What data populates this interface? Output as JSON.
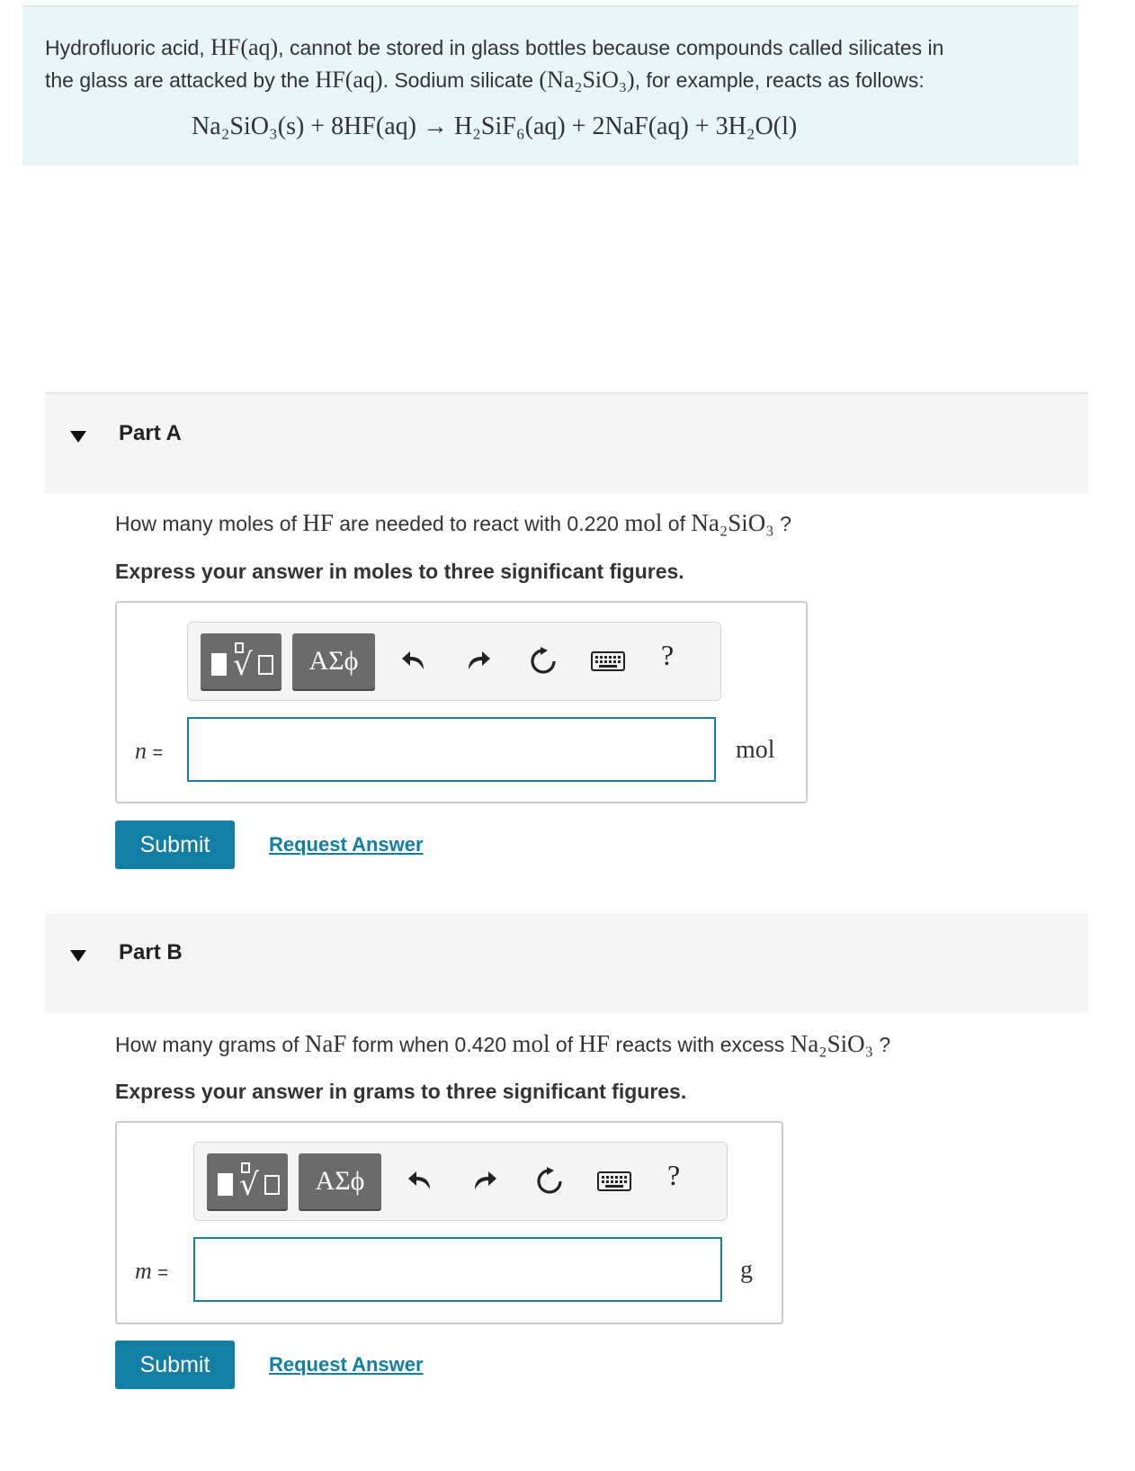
{
  "intro": {
    "line1_a": "Hydrofluoric acid, ",
    "line1_m1": "HF(aq)",
    "line1_b": ", cannot be stored in glass bottles because compounds called silicates in",
    "line2_a": "the glass are attacked by the ",
    "line2_m1": "HF(aq)",
    "line2_b": ". Sodium silicate ",
    "line2_m2": "(Na₂SiO₃)",
    "line2_c": ", for example, reacts as follows:",
    "equation": "Na₂SiO₃(s) + 8HF(aq) → H₂SiF₆(aq) + 2NaF(aq) + 3H₂O(l)"
  },
  "parts": [
    {
      "title": "Part A",
      "question_a": "How many moles of ",
      "question_m1": "HF",
      "question_b": " are needed to react with 0.220 ",
      "question_m2": "mol",
      "question_c": " of ",
      "question_m3": "Na₂SiO₃",
      "question_d": " ?",
      "instruction": "Express your answer in moles to three significant figures.",
      "toolbar": {
        "greek": "ΑΣϕ",
        "help": "?"
      },
      "variable": "n",
      "equals": "=",
      "input_value": "",
      "unit": "mol",
      "submit": "Submit",
      "request": "Request Answer"
    },
    {
      "title": "Part B",
      "question_a": "How many grams of ",
      "question_m1": "NaF",
      "question_b": " form when 0.420 ",
      "question_m2": "mol",
      "question_c": " of ",
      "question_m3": "HF",
      "question_d": " reacts with excess ",
      "question_m4": "Na₂SiO₃",
      "question_e": " ?",
      "instruction": "Express your answer in grams to three significant figures.",
      "toolbar": {
        "greek": "ΑΣϕ",
        "help": "?"
      },
      "variable": "m",
      "equals": "=",
      "input_value": "",
      "unit": "g",
      "submit": "Submit",
      "request": "Request Answer"
    }
  ],
  "icons": [
    "templates-icon",
    "greek-letters-icon",
    "undo-icon",
    "redo-icon",
    "reset-icon",
    "keyboard-icon",
    "help-icon",
    "collapse-triangle-icon"
  ],
  "colors": {
    "intro_bg": "#e9f6f7",
    "accent": "#127ea3",
    "toolbar_button": "#6b6b6b"
  }
}
